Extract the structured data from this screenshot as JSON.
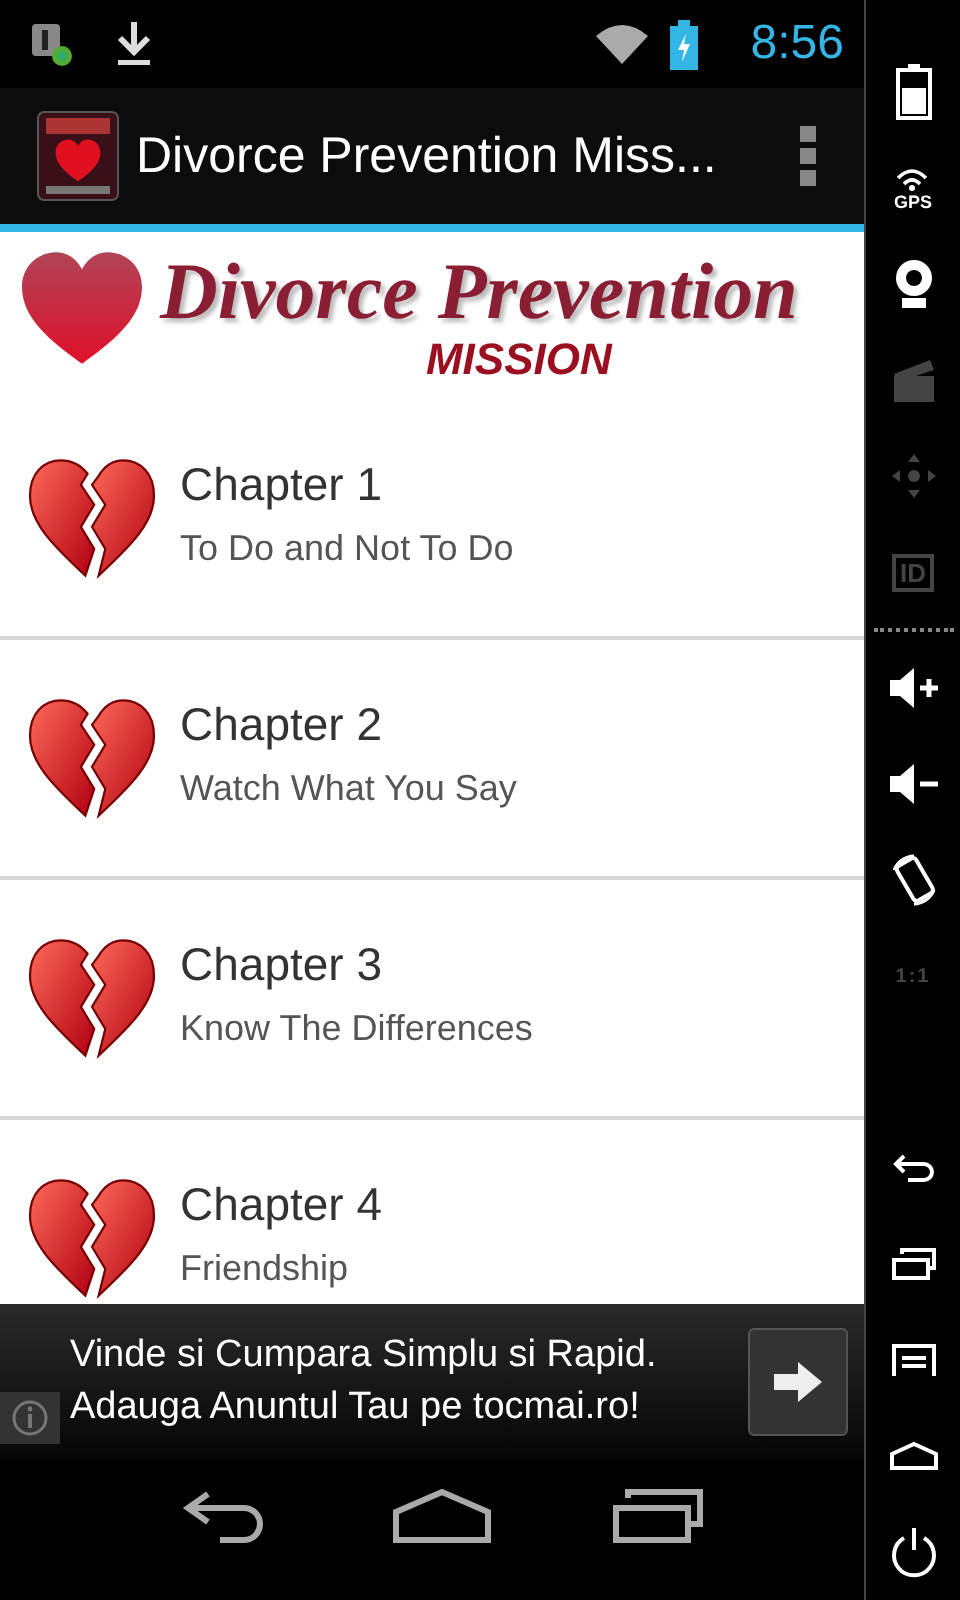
{
  "status_bar": {
    "time": "8:56"
  },
  "action_bar": {
    "title": "Divorce Prevention Miss..."
  },
  "banner": {
    "title": "Divorce Prevention",
    "subtitle": "MISSION"
  },
  "chapters": [
    {
      "title": "Chapter 1",
      "subtitle": "To Do and Not To Do"
    },
    {
      "title": "Chapter 2",
      "subtitle": "Watch What You Say"
    },
    {
      "title": "Chapter 3",
      "subtitle": "Know The Differences"
    },
    {
      "title": "Chapter 4",
      "subtitle": "Friendship"
    }
  ],
  "ad": {
    "lines": [
      "Vinde si Cumpara Simplu si Rapid.",
      "Adauga Anuntul Tau pe tocmai.ro!"
    ]
  },
  "emulator_controls": [
    {
      "kind": "battery",
      "disabled": false
    },
    {
      "kind": "gps",
      "label": "GPS",
      "disabled": false
    },
    {
      "kind": "camera",
      "disabled": false
    },
    {
      "kind": "clapper",
      "disabled": true
    },
    {
      "kind": "dpad",
      "disabled": true
    },
    {
      "kind": "id",
      "label": "ID",
      "disabled": true
    },
    {
      "kind": "divider"
    },
    {
      "kind": "volume_up",
      "disabled": false
    },
    {
      "kind": "volume_down",
      "disabled": false
    },
    {
      "kind": "rotate",
      "disabled": false
    },
    {
      "kind": "scale",
      "label": "1:1",
      "disabled": true
    },
    {
      "kind": "spacer"
    },
    {
      "kind": "back",
      "disabled": false
    },
    {
      "kind": "recent",
      "disabled": false
    },
    {
      "kind": "menu",
      "disabled": false
    },
    {
      "kind": "home",
      "disabled": false
    },
    {
      "kind": "power",
      "disabled": false
    }
  ]
}
